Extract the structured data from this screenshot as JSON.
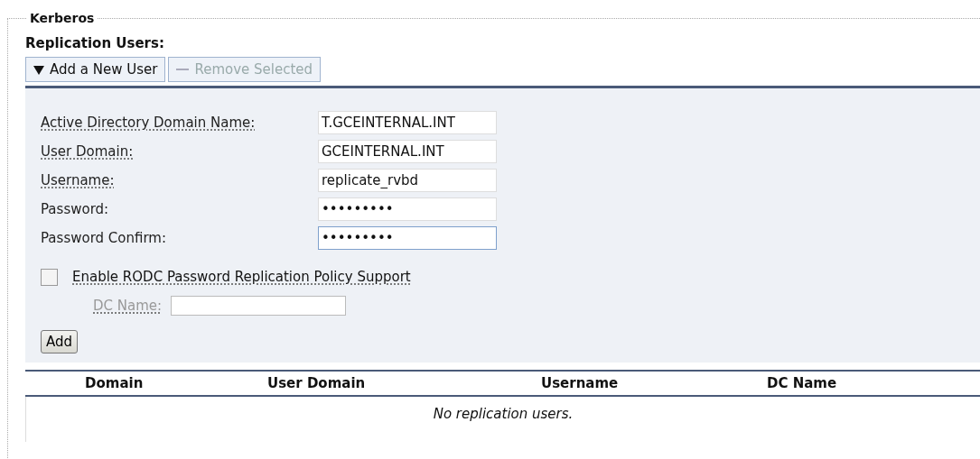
{
  "section": {
    "title": "Kerberos"
  },
  "heading": "Replication Users:",
  "toolbar": [
    {
      "label": "Add a New User",
      "kind": "expand",
      "disabled": false
    },
    {
      "label": "Remove Selected",
      "kind": "remove",
      "disabled": true
    }
  ],
  "form": {
    "fields": [
      {
        "label": "Active Directory Domain Name:",
        "value": "T.GCEINTERNAL.INT",
        "underlined": true,
        "focused": false
      },
      {
        "label": "User Domain:",
        "value": "GCEINTERNAL.INT",
        "underlined": true,
        "focused": false
      },
      {
        "label": "Username:",
        "value": "replicate_rvbd",
        "underlined": true,
        "focused": false
      },
      {
        "label": "Password:",
        "value": "•••••••••",
        "underlined": false,
        "focused": false
      },
      {
        "label": "Password Confirm:",
        "value": "•••••••••",
        "underlined": false,
        "focused": true
      }
    ],
    "rodc": {
      "label": "Enable RODC Password Replication Policy Support",
      "checked": false
    },
    "dc_name": {
      "label": "DC Name:",
      "disabled": true
    },
    "submit": "Add"
  },
  "table": {
    "columns": [
      "Domain",
      "User Domain",
      "Username",
      "DC Name"
    ],
    "empty_message": "No replication users."
  }
}
